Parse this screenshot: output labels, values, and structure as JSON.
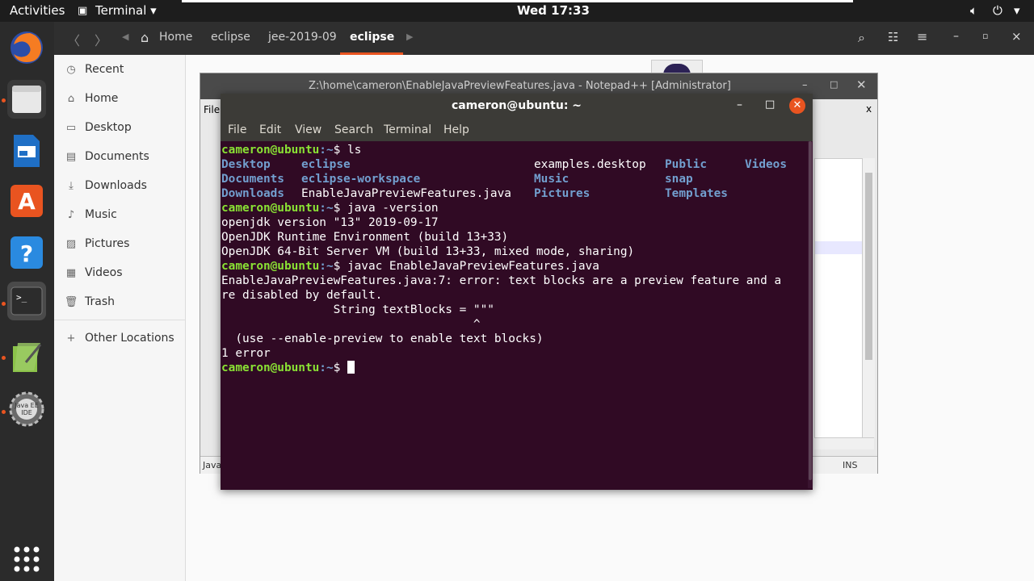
{
  "topbar": {
    "activities": "Activities",
    "app_name": "Terminal",
    "clock": "Wed 17:33"
  },
  "files": {
    "breadcrumbs": [
      "Home",
      "eclipse",
      "jee-2019-09",
      "eclipse"
    ],
    "sidebar": [
      {
        "label": "Recent",
        "icon": "clock-icon"
      },
      {
        "label": "Home",
        "icon": "home-icon"
      },
      {
        "label": "Desktop",
        "icon": "desktop-icon"
      },
      {
        "label": "Documents",
        "icon": "documents-icon"
      },
      {
        "label": "Downloads",
        "icon": "downloads-icon"
      },
      {
        "label": "Music",
        "icon": "music-icon"
      },
      {
        "label": "Pictures",
        "icon": "pictures-icon"
      },
      {
        "label": "Videos",
        "icon": "videos-icon"
      },
      {
        "label": "Trash",
        "icon": "trash-icon"
      },
      {
        "label": "Other Locations",
        "icon": "plus-icon"
      }
    ]
  },
  "notepad": {
    "title": "Z:\\home\\cameron\\EnableJavaPreviewFeatures.java - Notepad++ [Administrator]",
    "menu_file": "File",
    "status_left": "Java",
    "status_ins": "INS"
  },
  "terminal": {
    "title": "cameron@ubuntu: ~",
    "menu": [
      "File",
      "Edit",
      "View",
      "Search",
      "Terminal",
      "Help"
    ],
    "prompt_user": "cameron@ubuntu",
    "prompt_path": ":~",
    "prompt_symbol": "$ ",
    "cmd1": "ls",
    "ls": {
      "r1": [
        "Desktop",
        "eclipse",
        "examples.desktop",
        "Public",
        "Videos"
      ],
      "r2": [
        "Documents",
        "eclipse-workspace",
        "Music",
        "snap"
      ],
      "r3": [
        "Downloads",
        "EnableJavaPreviewFeatures.java",
        "Pictures",
        "Templates"
      ]
    },
    "cmd2": "java -version",
    "out2": [
      "openjdk version \"13\" 2019-09-17",
      "OpenJDK Runtime Environment (build 13+33)",
      "OpenJDK 64-Bit Server VM (build 13+33, mixed mode, sharing)"
    ],
    "cmd3": "javac EnableJavaPreviewFeatures.java",
    "out3": [
      "EnableJavaPreviewFeatures.java:7: error: text blocks are a preview feature and a",
      "re disabled by default.",
      "                String textBlocks = \"\"\"",
      "                                    ^",
      "  (use --enable-preview to enable text blocks)",
      "1 error"
    ]
  },
  "colors": {
    "terminal_bg": "#300a24",
    "prompt_green": "#8ae234",
    "dir_blue": "#729fcf",
    "accent_orange": "#e95420"
  }
}
